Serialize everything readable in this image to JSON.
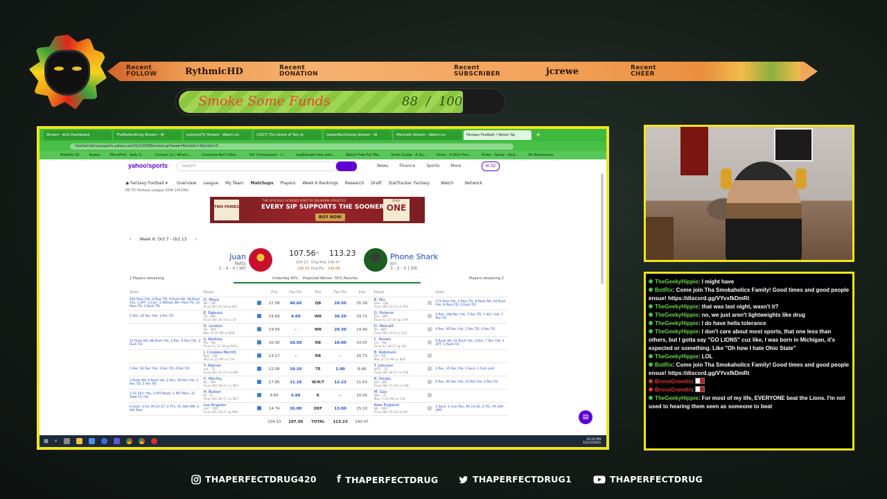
{
  "banner": {
    "recent_follow_label_1": "Recent",
    "recent_follow_label_2": "FOLLOW",
    "recent_follow_value": "RythmicHD",
    "recent_donation_label_1": "Recent",
    "recent_donation_label_2": "DONATION",
    "recent_donation_value": "",
    "recent_subscriber_label_1": "Recent",
    "recent_subscriber_label_2": "SUBSCRIBER",
    "recent_subscriber_value": "jcrewe",
    "recent_cheer_label_1": "Recent",
    "recent_cheer_label_2": "CHEER",
    "recent_cheer_value": ""
  },
  "goal": {
    "title": "Smoke Some Funds",
    "current": "88",
    "separator": "/",
    "target": "100",
    "fraction": 0.88
  },
  "browser": {
    "tabs": [
      "Stream - Kick Dashboard",
      "ThaPerfectDrug Stream - W",
      "justjamsTV Stream - Watch Liv",
      "(1627) The Ghost of Tom Jo",
      "QueenBuchCamp Stream - W",
      "Monicats Stream - Watch Liv",
      "Fantasy Football | Yahoo! Sp"
    ],
    "url": "football.fantasysports.yahoo.com/f1/145399/matchup?week=6&mid1=3&mid2=3",
    "bookmarks": [
      "MyKelly US",
      "Avatar",
      "MicroFind - Kelly S...",
      "Contact Us | What's...",
      "Connects Not Collec...",
      "DIY Compressor - C...",
      "expElevate free onlin...",
      "Watch Free Full Mo...",
      "Kinko Guide - A Gu...",
      "Kinko - A Kick Pres...",
      "Kinko - Setup - Kick...",
      "All Bookmarks"
    ]
  },
  "yahoo": {
    "logo": "yahoo!sports",
    "search_placeholder": "Search",
    "top_nav": [
      "News",
      "Finance",
      "Sports",
      "More"
    ],
    "mail_count": "32",
    "fantasy_section": "Fantasy Football",
    "sub_nav": [
      "Overview",
      "League",
      "My Team",
      "Matchups",
      "Players",
      "Week 6 Rankings",
      "Research",
      "Draft",
      "StatTracker"
    ],
    "right_nav": [
      "Fantasy",
      "Watch",
      "Network"
    ],
    "league_line": "PB TD Fantasy League (ID# 145399)",
    "ad_text": "EVERY SIP SUPPORTS THE SOONERS",
    "ad_small": "THE OFFICIALLY LICENSED SPIRIT OF OKLAHOMA ATHLETICS",
    "ad_button": "BUY NOW",
    "ad_brand_left": "TWO PONIES",
    "ad_brand_right_1": "Only",
    "ad_brand_right_2": "ONE",
    "week_label": "Week 6: Oct 7 - Oct 13",
    "team_left": {
      "name": "Juan",
      "owner": "Natty",
      "record": "1 - 4 - 0 | 9th",
      "score": "107.56",
      "proj": "154.13",
      "win_proj": "140.32"
    },
    "team_right": {
      "name": "Phone Shark",
      "owner": "Jon",
      "record": "3 - 2 - 0 | 5th",
      "score": "113.23",
      "proj": "140.47",
      "win_proj": "143.06"
    },
    "vs": "vs",
    "orig_proj_label": "Orig Proj",
    "proj_pts_label": "Proj Pts",
    "players_remaining_left": "2 Players remaining",
    "players_remaining_right": "Players remaining 2",
    "underdog": "Underdog 45%",
    "projected_winner": "Projected Winner",
    "favorite": "55% Favorite",
    "columns": [
      "Stats",
      "Player",
      "",
      "Proj",
      "Fan Pts",
      "Pos",
      "Fan Pts",
      "Proj",
      "Player",
      "",
      "Stats"
    ],
    "rows": [
      {
        "lstat": "263 Pass Yds, 4 Pass TD, 9 Rush Att, 28 Rush Yds, 1 2PT, 3 Carr, 5 Attmpt 48+ Pass TD, 12 Pass TD, 1 Rush TD",
        "lp": "D. Maye",
        "lt": "NE - QB",
        "lg": "Final (W) 25-19 @ NO",
        "lproj": "27.08",
        "lpts": "40.60",
        "pos": "QB",
        "rpts": "20.50",
        "rproj": "25.39",
        "rp": "B. Nix",
        "rt": "Den - QB",
        "rg": "Final (W) 13-11 vs NYJ",
        "rstat": "174 Pass Yds, 1 Pass TD, 8 Rush Att, 34 Rush Yds, 9 Pass FD, 3 Rush FD"
      },
      {
        "lstat": "2 Rec, 24 Rec Yds, 1 Rec FD",
        "lp": "E. Egbuka",
        "lt": "TB - WR",
        "lg": "Final (W) 30-19 vs SF",
        "lproj": "19.69",
        "lpts": "4.60",
        "pos": "WR",
        "rpts": "36.20",
        "rproj": "19.71",
        "rp": "G. Pickens",
        "rt": "Dal - WR",
        "rg": "Final (L) 27-30 @ CAR",
        "rstat": "9 Rec, 168 Rec Yds, 1 Rec TD, 1 40+ Yds, 7 Rec FD"
      },
      {
        "lstat": "",
        "lp": "D. London",
        "lt": "Atl - WR",
        "lg": "Mon 6:15 PM vs BUF",
        "lproj": "19.59",
        "lpts": "-",
        "pos": "WR",
        "rpts": "20.30",
        "rproj": "14.40",
        "rp": "D. Metcalf",
        "rt": "Pit - WR",
        "rg": "Final (W) 23-9 vs CLE",
        "rstat": "4 Rec, 95 Rec Yds, 1 Rec TD, 4 Rec FD"
      },
      {
        "lstat": "12 Rush Att, 68 Rush Yds, 2 Rec, 9 Rec Yds, 3 Rush FD",
        "lp": "S. Barkley",
        "lt": "Phi - RB",
        "lg": "Final (L) 17-34 @ NYG",
        "lproj": "20.30",
        "lpts": "10.50",
        "pos": "RB",
        "rpts": "10.00",
        "rproj": "14.55",
        "rp": "C. Brown",
        "rt": "Cin - RB",
        "rg": "Final (L) 18-27 @ GB",
        "rstat": "9 Rush Att, 41 Rush Yds, 3 Rec, 7 Rec Yds, 1 2PT, 1 Rush FD"
      },
      {
        "lstat": "",
        "lp": "J. Croskey-Merritt",
        "lt": "Was - RB",
        "lg": "Mon 6:15 PM vs CHI",
        "lproj": "13.17",
        "lpts": "-",
        "pos": "RB",
        "rpts": "-",
        "rproj": "20.73",
        "rp": "B. Robinson",
        "rt": "Atl - RB",
        "rg": "Mon 6:15 PM vs BUF",
        "rstat": ""
      },
      {
        "lstat": "5 Rec, 63 Rec Yds, 1 Rec TD, 4 Rec FD",
        "lp": "T. Warren",
        "lt": "Ind - TE",
        "lg": "Final (W) 31-27 vs ARI",
        "lproj": "12.06",
        "lpts": "19.10",
        "pos": "TE",
        "rpts": "1.00",
        "rproj": "8.66",
        "rp": "T. Johnson",
        "rt": "NYG - TE",
        "rg": "Final (W) 34-17 vs PHI",
        "rstat": "2 Rec, 15 Rec Yds, 1 Sum, 1 Fum Lost"
      },
      {
        "lstat": "3 Rush Att, 6 Rush Yds, 2 Rec, 28 Rec Yds, 1 Rec TD, 2 Rec FD",
        "lp": "X. Worthy",
        "lt": "KC - WR",
        "lg": "Final (W) 30-17 vs DET",
        "lproj": "17.85",
        "lpts": "11.10",
        "pos": "W/R/T",
        "rpts": "12.23",
        "rproj": "11.93",
        "rp": "R. Doubs",
        "rt": "GB - WR",
        "rg": "Final (W) 27-18 vs CIN",
        "rstat": "6 Rec, 95 Rec Yds, 14 Ret Yds, 4 Rec FD"
      },
      {
        "lstat": "1 FG 50+ Yds, 3 PAT Made, 1 PAT Miss, 31 Total FG Yds",
        "lp": "H. Butker",
        "lt": "KC - K",
        "lg": "Final (W) 30-17 vs DET",
        "lproj": "9.65",
        "lpts": "5.66",
        "pos": "K",
        "rpts": "-",
        "rproj": "10.00",
        "rp": "M. Gay",
        "rt": "Was - K",
        "rg": "Mon 7:15 PM vs CHI",
        "rstat": ""
      },
      {
        "lstat": "6 Sack, 3 Int, PA 21-27, 4 TFL, YA 300-399, 2 4th Dwn",
        "lp": "Los Angeles",
        "lt": "LAC - DEF",
        "lg": "Final (W) 29-27 @ MIA",
        "lproj": "14.74",
        "lpts": "16.00",
        "pos": "DEF",
        "rpts": "13.00",
        "rproj": "15.10",
        "rp": "New England",
        "rt": "NE - DEF",
        "rg": "Final (W) 25-19 @ NO",
        "rstat": "2 Sack, 1 Fum Rec, PA 14-20, 4 TFL, YA 200-299"
      }
    ],
    "totals": {
      "lproj": "154.13",
      "lpts": "107.56",
      "label": "TOTAL",
      "rpts": "113.23",
      "rproj": "140.47"
    }
  },
  "taskbar": {
    "time": "10:10 PM",
    "date": "10/12/2025"
  },
  "chat": [
    {
      "user": "TheGeekyHippie",
      "text": ": I might have",
      "type": "geek"
    },
    {
      "user": "BotRix",
      "text": ": Come join Tha Smokaholics Family! Good times and good people ensue! https://discord.gg/VYvxfkDmRt",
      "type": "bot"
    },
    {
      "user": "TheGeekyHippie",
      "text": ": that was last night, wasn't it?",
      "type": "geek"
    },
    {
      "user": "TheGeekyHippie",
      "text": ": no, we just aren't lightweights like drug",
      "type": "geek"
    },
    {
      "user": "TheGeekyHippie",
      "text": ": I do have hella tolerance",
      "type": "geek"
    },
    {
      "user": "TheGeekyHippie",
      "text": ": I don't care about most sports, that one less than others, but I gotta say \"GO LIONS\" cuz like, I was born in Michigan, it's expected or something. Like \"Oh how I hate Ohio State\"",
      "type": "geek"
    },
    {
      "user": "TheGeekyHippie",
      "text": ": LOL",
      "type": "geek"
    },
    {
      "user": "BotRix",
      "text": ": Come join Tha Smokaholics Family! Good times and good people ensue! https://discord.gg/VYvxfkDmRt",
      "type": "bot"
    },
    {
      "user": "BronxGremlin",
      "text": ":",
      "type": "bronx",
      "emote": true
    },
    {
      "user": "BronxGremlin",
      "text": ":",
      "type": "bronx",
      "emote": true
    },
    {
      "user": "TheGeekyHippie",
      "text": ": For most of my life, EVERYONE beat the Lions. I'm not used to hearing them seen as someone to beat",
      "type": "geek"
    }
  ],
  "social": {
    "instagram": "THAPERFECTDRUG420",
    "facebook": "THAPERFECTDRUG",
    "twitter": "THAPERFECTDRUG1",
    "youtube": "THAPERFECTDRUG"
  },
  "colors": {
    "frame": "#f2e61a",
    "goal_fill": "#9fd651",
    "ribbon": "#f3a35b",
    "chat_user": "#6ed34a",
    "chat_bronx": "#d9372f"
  }
}
